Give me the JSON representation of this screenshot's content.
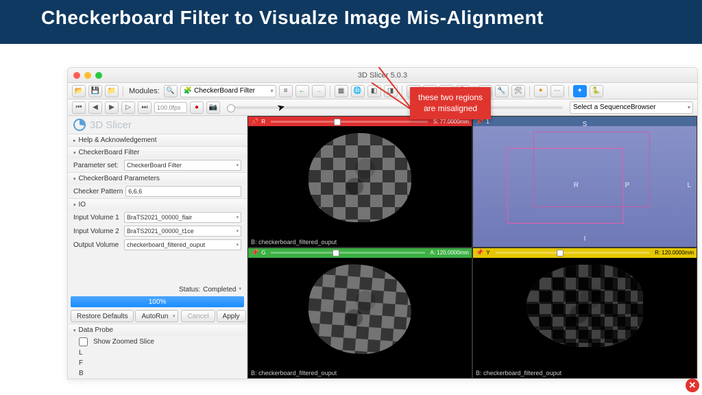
{
  "banner": {
    "title": "Checkerboard Filter to Visualze Image Mis-Alignment"
  },
  "window": {
    "title": "3D Slicer 5.0.3"
  },
  "toolbar": {
    "modules_label": "Modules:",
    "module_selected": "CheckerBoard Filter",
    "fps": "100.0fps",
    "sequence_placeholder": "Select a SequenceBrowser"
  },
  "sidebar": {
    "app_name": "3D Slicer",
    "help_label": "Help & Acknowledgement",
    "filter_section": "CheckerBoard Filter",
    "param_set_label": "Parameter set:",
    "param_set_value": "CheckerBoard Filter",
    "params_section": "CheckerBoard Parameters",
    "checker_label": "Checker Pattern",
    "checker_value": "6,6,6",
    "io_section": "IO",
    "iv1_label": "Input Volume 1",
    "iv1_value": "BraTS2021_00000_flair",
    "iv2_label": "Input Volume 2",
    "iv2_value": "BraTS2021_00000_t1ce",
    "ov_label": "Output Volume",
    "ov_value": "checkerboard_filtered_ouput",
    "status_label": "Status:",
    "status_value": "Completed",
    "progress": "100%",
    "restore": "Restore Defaults",
    "autorun": "AutoRun",
    "cancel": "Cancel",
    "apply": "Apply",
    "dataprobe": "Data Probe",
    "zoomed": "Show Zoomed Slice",
    "probe_L": "L",
    "probe_F": "F",
    "probe_B": "B"
  },
  "views": {
    "red": {
      "label": "R",
      "value": "S: 77.0000mm",
      "bottom": "B: checkerboard_filtered_ouput"
    },
    "blue": {
      "S": "S",
      "R": "R",
      "L": "L",
      "P": "P",
      "I": "I"
    },
    "green": {
      "label": "G",
      "value": "A: 120.0000mm",
      "bottom": "B: checkerboard_filtered_ouput"
    },
    "yellow": {
      "label": "Y",
      "value": "R: 120.0000mm",
      "bottom": "B: checkerboard_filtered_ouput"
    }
  },
  "annotation": {
    "line1": "these two regions",
    "line2": "are misaligned"
  }
}
